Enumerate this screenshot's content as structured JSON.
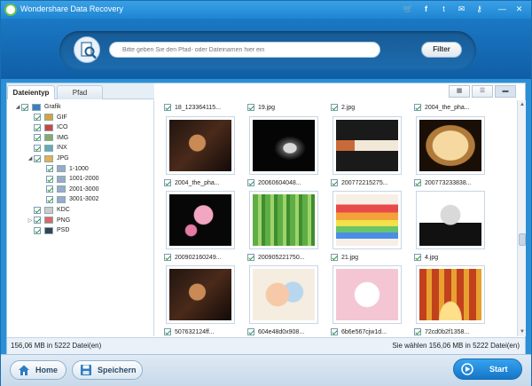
{
  "window": {
    "title": "Wondershare Data Recovery"
  },
  "titlebar_icons": [
    "cart-icon",
    "facebook-icon",
    "twitter-icon",
    "feedback-icon",
    "key-icon",
    "minimize-icon",
    "close-icon"
  ],
  "search": {
    "placeholder": "Bitte geben Sie den Pfad- oder Dateinamen hier ein",
    "filter_label": "Filter"
  },
  "tabs": [
    {
      "label": "Dateientyp",
      "active": true
    },
    {
      "label": "Pfad",
      "active": false
    }
  ],
  "view_modes": [
    "thumbnail-view-icon",
    "list-view-icon",
    "detail-view-icon"
  ],
  "tree": [
    {
      "label": "Grafik",
      "level": 0,
      "expanded": true
    },
    {
      "label": "GIF",
      "level": 1
    },
    {
      "label": "ICO",
      "level": 1
    },
    {
      "label": "IMG",
      "level": 1
    },
    {
      "label": "INX",
      "level": 1
    },
    {
      "label": "JPG",
      "level": 1,
      "expanded": true
    },
    {
      "label": "1-1000",
      "level": 2
    },
    {
      "label": "1001-2000",
      "level": 2
    },
    {
      "label": "2001-3000",
      "level": 2
    },
    {
      "label": "3001-3002",
      "level": 2
    },
    {
      "label": "KDC",
      "level": 1
    },
    {
      "label": "PNG",
      "level": 1,
      "collapsed": true
    },
    {
      "label": "PSD",
      "level": 1
    }
  ],
  "top_row": [
    "18_123364115...",
    "19.jpg",
    "2.jpg",
    "2004_the_pha..."
  ],
  "files": [
    {
      "name": "2004_the_pha...",
      "thumb": "dark-portrait"
    },
    {
      "name": "20060604048...",
      "thumb": "black-silhouette"
    },
    {
      "name": "200772215275...",
      "thumb": "cigarette"
    },
    {
      "name": "200773233838...",
      "thumb": "frame"
    },
    {
      "name": "200902160249...",
      "thumb": "floral-black"
    },
    {
      "name": "200905221750...",
      "thumb": "bamboo"
    },
    {
      "name": "21.jpg",
      "thumb": "rainbow-cake"
    },
    {
      "name": "4.jpg",
      "thumb": "portrait-bw"
    },
    {
      "name": "507632124ff...",
      "thumb": "dark-portrait"
    },
    {
      "name": "604e48d0x908...",
      "thumb": "pastel"
    },
    {
      "name": "6b6e567cjw1d...",
      "thumb": "cat"
    },
    {
      "name": "72cd0b2f1358...",
      "thumb": "golden-arch"
    }
  ],
  "status": {
    "left": "156,06 MB in 5222 Datei(en)",
    "right": "Sie wählen 156,06 MB in 5222 Datei(en)"
  },
  "buttons": {
    "home": "Home",
    "save": "Speichern",
    "start": "Start"
  },
  "colors": {
    "brand_blue": "#1f86d3",
    "check_green": "#2a9a2a"
  }
}
